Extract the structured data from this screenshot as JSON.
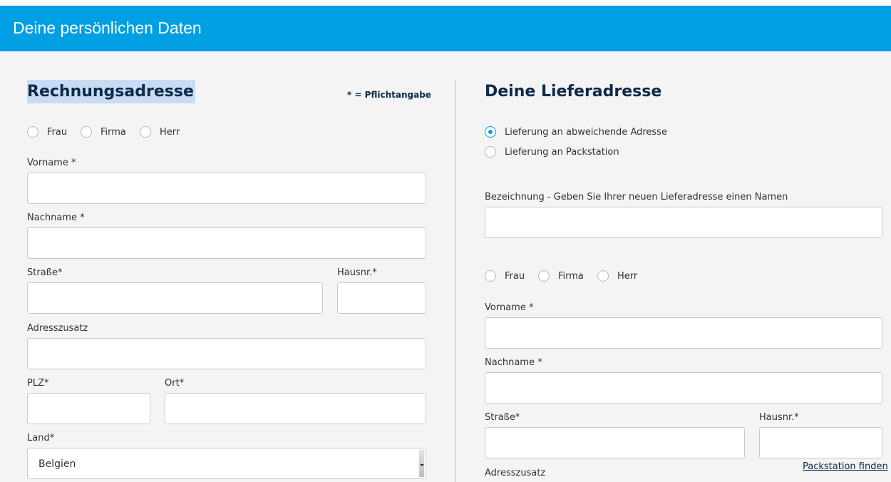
{
  "header": {
    "title": "Deine persönlichen Daten"
  },
  "billing": {
    "title": "Rechnungsadresse",
    "required_note": "* = Pflichtangabe",
    "salutations": [
      "Frau",
      "Firma",
      "Herr"
    ],
    "firstname_label": "Vorname *",
    "lastname_label": "Nachname *",
    "street_label": "Straße*",
    "housenr_label": "Hausnr.*",
    "addition_label": "Adresszusatz",
    "zip_label": "PLZ*",
    "city_label": "Ort*",
    "country_label": "Land*",
    "country_value": "Belgien"
  },
  "delivery": {
    "title": "Deine Lieferadresse",
    "options": [
      "Lieferung an abweichende Adresse",
      "Lieferung an Packstation"
    ],
    "selected_option": "Lieferung an abweichende Adresse",
    "name_label": "Bezeichnung - Geben Sie Ihrer neuen Lieferadresse einen Namen",
    "salutations": [
      "Frau",
      "Firma",
      "Herr"
    ],
    "firstname_label": "Vorname *",
    "lastname_label": "Nachname *",
    "street_label": "Straße*",
    "housenr_label": "Hausnr.*",
    "packstation_link": "Packstation finden",
    "addition_label": "Adresszusatz"
  },
  "colors": {
    "accent": "#009fe3",
    "heading": "#0d2a4a",
    "background": "#f4f4f4"
  }
}
